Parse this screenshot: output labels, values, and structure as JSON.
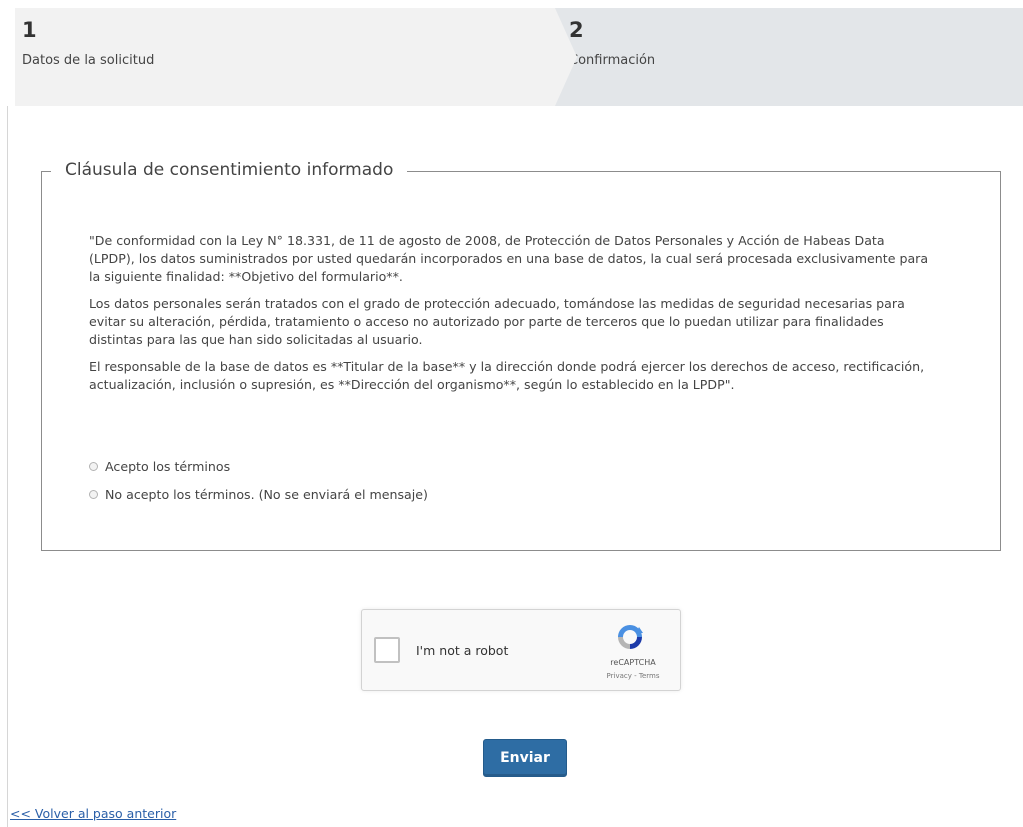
{
  "stepper": {
    "steps": [
      {
        "number": "1",
        "label": "Datos de la solicitud",
        "state": "active"
      },
      {
        "number": "2",
        "label": "Confirmación",
        "state": "inactive"
      }
    ]
  },
  "consent": {
    "legend": "Cláusula de consentimiento informado",
    "paragraphs": [
      "\"De conformidad con la Ley N° 18.331, de 11 de agosto de 2008, de Protección de Datos Personales y Acción de Habeas Data (LPDP), los datos suministrados por usted quedarán incorporados en una base de datos, la cual será procesada exclusivamente para la siguiente finalidad: **Objetivo del formulario**.",
      "Los datos personales serán tratados con el grado de protección adecuado, tomándose las medidas de seguridad necesarias para evitar su alteración, pérdida, tratamiento o acceso no autorizado por parte de terceros que lo puedan utilizar para finalidades distintas para las que han sido solicitadas al usuario.",
      "El responsable de la base de datos es **Titular de la base** y la dirección donde podrá ejercer los derechos de acceso, rectificación, actualización, inclusión o supresión, es **Dirección del organismo**, según lo establecido en la LPDP\"."
    ],
    "options": [
      {
        "label": "Acepto los términos"
      },
      {
        "label": "No acepto los términos. (No se enviará el mensaje)"
      }
    ]
  },
  "recaptcha": {
    "label": "I'm not a robot",
    "brand": "reCAPTCHA",
    "links": "Privacy - Terms"
  },
  "actions": {
    "submit_label": "Enviar",
    "back_label": "<< Volver al paso anterior"
  },
  "colors": {
    "primary_button": "#2e6da4",
    "link": "#2a5fa8",
    "step_active_bg": "#f2f2f2",
    "step_inactive_bg": "#e3e6e9"
  }
}
